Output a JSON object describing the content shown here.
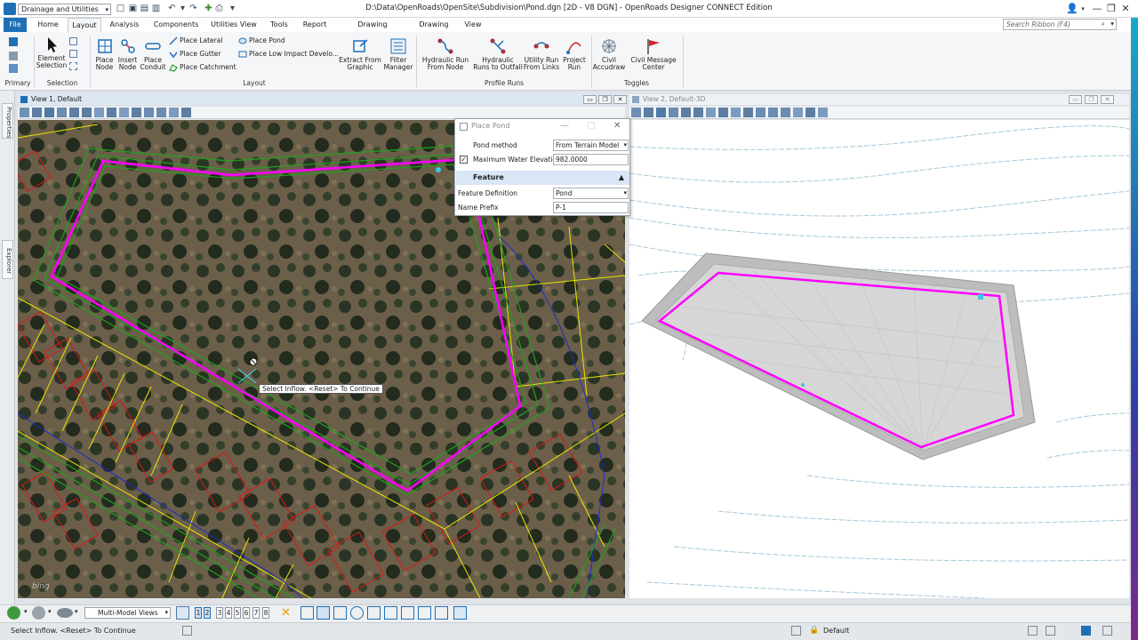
{
  "titlebar": {
    "workflow": "Drainage and Utilities",
    "title": "D:\\Data\\OpenRoads\\OpenSite\\Subdivision\\Pond.dgn [2D - V8 DGN] - OpenRoads Designer CONNECT Edition",
    "search_placeholder": "Search Ribbon (F4)"
  },
  "tabs": [
    "File",
    "Home",
    "Layout",
    "Analysis",
    "Components",
    "Utilities View",
    "Tools",
    "Report",
    "Drawing Production",
    "Drawing",
    "View"
  ],
  "active_tab": "Layout",
  "ribbon": {
    "groups": {
      "primary": "Primary",
      "selection": "Selection",
      "layout": "Layout",
      "profile_runs": "Profile Runs",
      "toggles": "Toggles"
    },
    "element_selection": "Element Selection",
    "place_node": "Place Node",
    "insert_node": "Insert Node",
    "place_conduit": "Place Conduit",
    "place_lateral": "Place Lateral",
    "place_gutter": "Place Gutter",
    "place_catchment": "Place Catchment",
    "place_pond": "Place Pond",
    "place_low_impact": "Place Low Impact Develo...",
    "extract": "Extract From Graphic",
    "filter_manager": "Filter Manager",
    "hydraulic_run": "Hydraulic Run From Node",
    "hydraulic_runs_outfall": "Hydraulic Runs to Outfall",
    "utility_run": "Utility Run From Links",
    "project_run": "Project Run",
    "civil_accudraw": "Civil Accudraw",
    "civil_message_center": "Civil Message Center"
  },
  "panels": {
    "properties": "Properties",
    "explorer": "Explorer"
  },
  "view1": {
    "title": "View 1, Default",
    "watermark": "bing"
  },
  "view2": {
    "title": "View 2, Default-3D"
  },
  "dialog": {
    "title": "Place Pond",
    "pond_method_label": "Pond method",
    "pond_method_value": "From Terrain Model",
    "max_water_label": "Maximum Water Elevation",
    "max_water_value": "982.0000",
    "max_water_checked": true,
    "section": "Feature",
    "feature_def_label": "Feature Definition",
    "feature_def_value": "Pond",
    "name_prefix_label": "Name Prefix",
    "name_prefix_value": "P-1"
  },
  "tooltip": "Select Inflow. <Reset> To Continue",
  "bottombar": {
    "views_dropdown": "Multi-Model Views",
    "view_numbers": [
      "1",
      "2",
      "3",
      "4",
      "5",
      "6",
      "7",
      "8"
    ]
  },
  "status": {
    "prompt": "Select Inflow. <Reset> To Continue",
    "level": "Default"
  },
  "colors": {
    "accent": "#1f6fb5",
    "pond_outline": "#ff00ff",
    "grading": "#1fa21f",
    "lot_lines": "#e01515",
    "property_lines": "#e6e600"
  }
}
